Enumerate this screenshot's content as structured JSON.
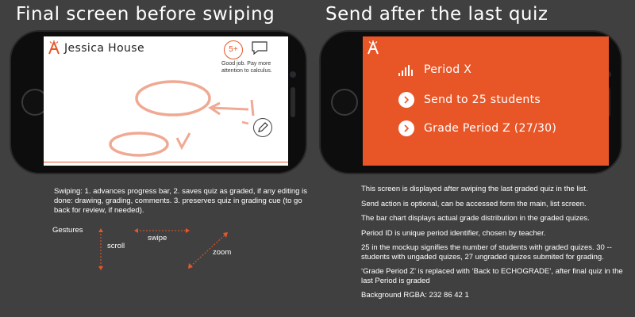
{
  "headings": {
    "left": "Final screen before swiping",
    "right": "Send after the last quiz"
  },
  "left_screen": {
    "student_name": "Jessica House",
    "score_badge": "5+",
    "comment": "Good job. Pay more attention to calculus.",
    "logo_icon": "echograde-logo-icon",
    "comment_icon": "speech-bubble-icon",
    "edit_icon": "pencil-icon"
  },
  "right_screen": {
    "background": "#e85628",
    "period_label": "Period X",
    "send_label": "Send to 25 students",
    "grade_label": "Grade Period Z (27/30)",
    "logo_icon": "echograde-logo-icon",
    "chart_icon": "bar-chart-icon",
    "arrow_icon": "chevron-right-icon"
  },
  "left_notes": {
    "swiping": "Swiping: 1. advances progress bar, 2. saves quiz as graded, if any editing is done: drawing, grading, comments. 3. preserves quiz in grading cue (to go back for review, if needed).",
    "gestures_title": "Gestures",
    "scroll": "scroll",
    "swipe": "swipe",
    "zoom": "zoom"
  },
  "right_notes": [
    "This screen is displayed after swiping the last graded quiz in the list.",
    "Send action is optional, can be accessed form the main, list screen.",
    "The bar chart displays actual grade distribution in the graded quizes.",
    "Period ID is unique period identifier, chosen by teacher.",
    "25 in the mockup signifies the number of students with graded quizes. 30 -- students with ungaded quizes, 27 ungraded quizes submited for grading.",
    "‘Grade Period Z’ is replaced with ‘Back to ECHOGRADE’, after final quiz in the last Period is graded",
    "Background RGBA: 232 86 42 1"
  ],
  "colors": {
    "accent": "#e85628",
    "page_bg": "#404040"
  }
}
